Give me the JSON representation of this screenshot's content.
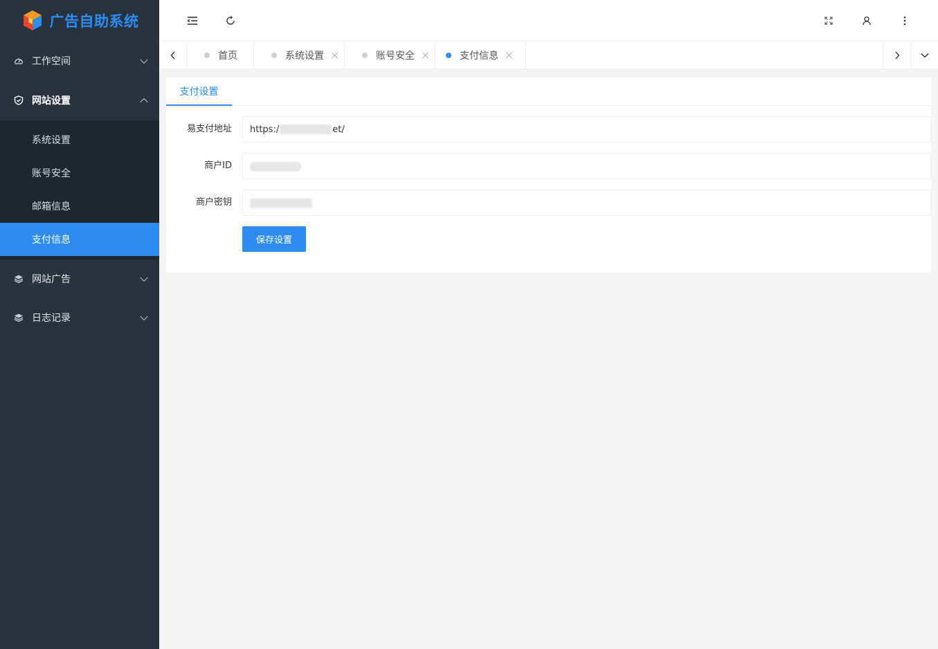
{
  "app": {
    "title": "广告自助系统",
    "brand_color": "#2b8cf3"
  },
  "sidebar": {
    "groups": [
      {
        "label": "工作空间",
        "icon": "dashboard-icon",
        "expanded": false
      },
      {
        "label": "网站设置",
        "icon": "shield-check-icon",
        "expanded": true
      },
      {
        "label": "网站广告",
        "icon": "layers-icon",
        "expanded": false
      },
      {
        "label": "日志记录",
        "icon": "layers-icon",
        "expanded": false
      }
    ],
    "submenu": [
      {
        "label": "系统设置",
        "active": false
      },
      {
        "label": "账号安全",
        "active": false
      },
      {
        "label": "邮箱信息",
        "active": false
      },
      {
        "label": "支付信息",
        "active": true
      }
    ]
  },
  "header": {
    "icons": [
      "menu-fold-icon",
      "refresh-icon",
      "fullscreen-icon",
      "user-icon",
      "more-vertical-icon"
    ]
  },
  "tabs": [
    {
      "label": "首页",
      "closable": false,
      "active": false
    },
    {
      "label": "系统设置",
      "closable": true,
      "active": false
    },
    {
      "label": "账号安全",
      "closable": true,
      "active": false
    },
    {
      "label": "支付信息",
      "closable": true,
      "active": true
    }
  ],
  "card": {
    "tab_label": "支付设置",
    "fields": [
      {
        "label": "易支付地址",
        "value": "https:/",
        "suffix": "et/"
      },
      {
        "label": "商户ID",
        "value": ""
      },
      {
        "label": "商户密钥",
        "value": ""
      }
    ],
    "save_label": "保存设置"
  },
  "colors": {
    "accent": "#2d8cf0",
    "sidebar_bg": "#28333e",
    "submenu_bg": "#1e2730"
  }
}
